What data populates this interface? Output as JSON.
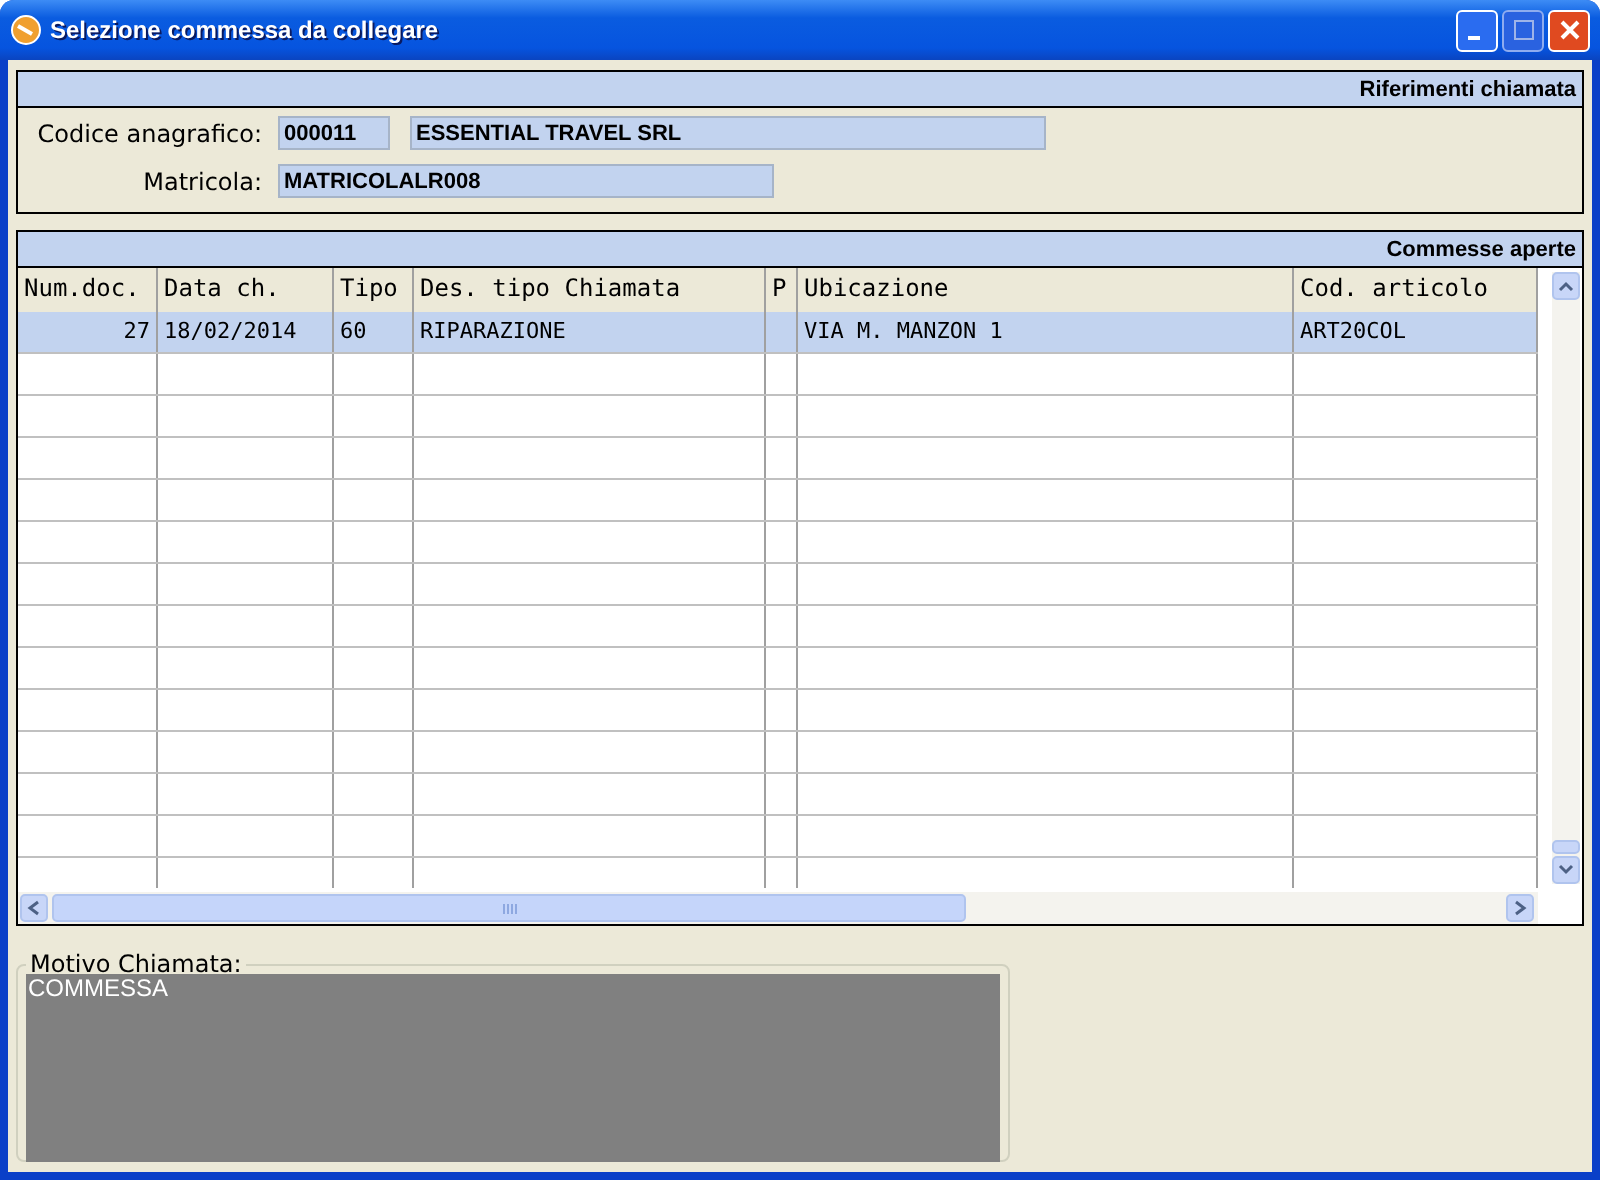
{
  "window": {
    "title": "Selezione commessa da collegare"
  },
  "riferimenti": {
    "title": "Riferimenti chiamata",
    "codice_label": "Codice anagrafico:",
    "codice": "000011",
    "ragione_sociale": "ESSENTIAL TRAVEL SRL",
    "matricola_label": "Matricola:",
    "matricola": "MATRICOLALR008"
  },
  "table": {
    "title": "Commesse aperte",
    "columns": [
      "Num.doc.",
      "Data ch.",
      "Tipo",
      "Des. tipo Chiamata",
      "P",
      "Ubicazione",
      "Cod. articolo"
    ],
    "rows": [
      {
        "selected": true,
        "cells": [
          "27",
          "18/02/2014",
          "60",
          "RIPARAZIONE",
          "",
          "VIA M. MANZON 1",
          "ART20COL"
        ]
      }
    ]
  },
  "motivo": {
    "label": "Motivo Chiamata:",
    "value": "COMMESSA"
  }
}
